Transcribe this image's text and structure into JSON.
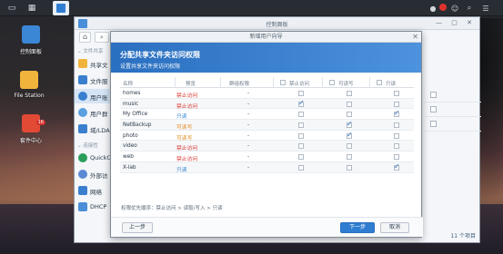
{
  "desktop": {
    "icons": [
      {
        "label": "控制面板",
        "color": "#3c86d6"
      },
      {
        "label": "File Station",
        "color": "#f0b43c"
      },
      {
        "label": "套件中心",
        "color": "#e24a35",
        "badge": "16"
      }
    ]
  },
  "control_panel": {
    "title": "控制面板",
    "sections": [
      "文件共享",
      "连接性"
    ],
    "items": [
      {
        "label": "共享文",
        "color": "#f0b43c"
      },
      {
        "label": "文件服",
        "color": "#3a7fce"
      },
      {
        "label": "用户账",
        "color": "#3a7fce",
        "selected": true
      },
      {
        "label": "用户群",
        "color": "#5aa0e0"
      },
      {
        "label": "域/LDA",
        "color": "#3a7fce"
      },
      {
        "label": "QuickC",
        "color": "#2b9e5b"
      },
      {
        "label": "外部访",
        "color": "#5b8ad4"
      },
      {
        "label": "网络",
        "color": "#3a7fce"
      },
      {
        "label": "DHCP",
        "color": "#4a8fd8"
      }
    ],
    "pager": "11 个项目"
  },
  "wizard": {
    "title": "新增用户向导",
    "heading": "分配共享文件夹访问权限",
    "subheading": "设置共享文件夹访问权限",
    "columns": {
      "name": "名称",
      "preview": "预览",
      "acl": "群组权限",
      "deny": "禁止访问",
      "rw": "可读写",
      "ro": "只读"
    },
    "rows": [
      {
        "name": "homes",
        "preview": "禁止访问",
        "acl": "-",
        "deny": false,
        "rw": false,
        "ro": false
      },
      {
        "name": "music",
        "preview": "禁止访问",
        "acl": "-",
        "deny": true,
        "rw": false,
        "ro": false
      },
      {
        "name": "My Office",
        "preview": "只读",
        "acl": "-",
        "deny": false,
        "rw": false,
        "ro": true
      },
      {
        "name": "NetBackup",
        "preview": "可读写",
        "acl": "-",
        "deny": false,
        "rw": true,
        "ro": false
      },
      {
        "name": "photo",
        "preview": "可读写",
        "acl": "-",
        "deny": false,
        "rw": true,
        "ro": false
      },
      {
        "name": "video",
        "preview": "禁止访问",
        "acl": "-",
        "deny": false,
        "rw": false,
        "ro": false
      },
      {
        "name": "web",
        "preview": "禁止访问",
        "acl": "-",
        "deny": false,
        "rw": false,
        "ro": false
      },
      {
        "name": "X-lab",
        "preview": "只读",
        "acl": "-",
        "deny": false,
        "rw": false,
        "ro": true
      }
    ],
    "note": "权限优先顺序：禁止访问 > 读取/写入 > 只读",
    "buttons": {
      "back": "上一步",
      "next": "下一步",
      "cancel": "取消"
    },
    "colors": {
      "deny": "#d9332b",
      "rw": "#e08a1e",
      "ro": "#2a7fd1",
      "accent": "#2f7dd1"
    }
  }
}
